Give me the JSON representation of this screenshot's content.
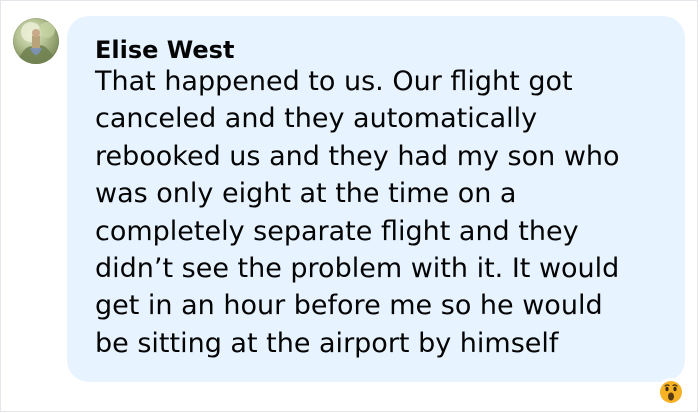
{
  "comment": {
    "author": "Elise West",
    "text": "That happened to us. Our flight got\ncanceled and they automatically\nrebooked us and they had my son who\nwas only eight at the time on a\ncompletely separate flight and they\ndidn’t see the problem with it. It would\nget in an hour before me so he would\nbe sitting at the airport by himself"
  },
  "reaction": {
    "icon": "wow-emoji-icon"
  },
  "colors": {
    "bubble": "#e7f3ff",
    "text": "#050505",
    "reaction_yellow": "#f7b125"
  }
}
